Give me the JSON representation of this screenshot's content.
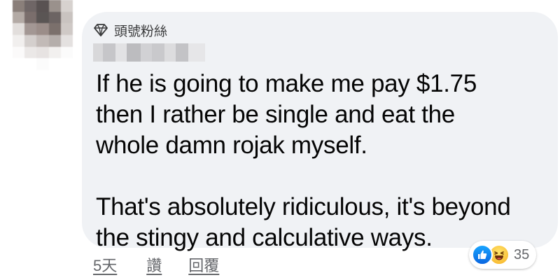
{
  "comment": {
    "badge_label": "頭號粉絲",
    "badge_icon": "diamond-icon",
    "author_name_blurred": true,
    "paragraphs": [
      "If he is going to make me pay $1.75\nthen I rather be single and eat the\nwhole damn rojak myself.",
      "That's absolutely ridiculous, it's beyond\nthe stingy and calculative ways."
    ]
  },
  "actions": {
    "time": "5天",
    "like": "讚",
    "reply": "回覆"
  },
  "reactions": {
    "icons": [
      "like-icon",
      "haha-icon"
    ],
    "count": "35"
  },
  "colors": {
    "bubble": "#f0f2f5",
    "text": "#050505",
    "secondary": "#65676b",
    "like_blue": "#1877f2",
    "haha_yellow": "#f7b125"
  }
}
